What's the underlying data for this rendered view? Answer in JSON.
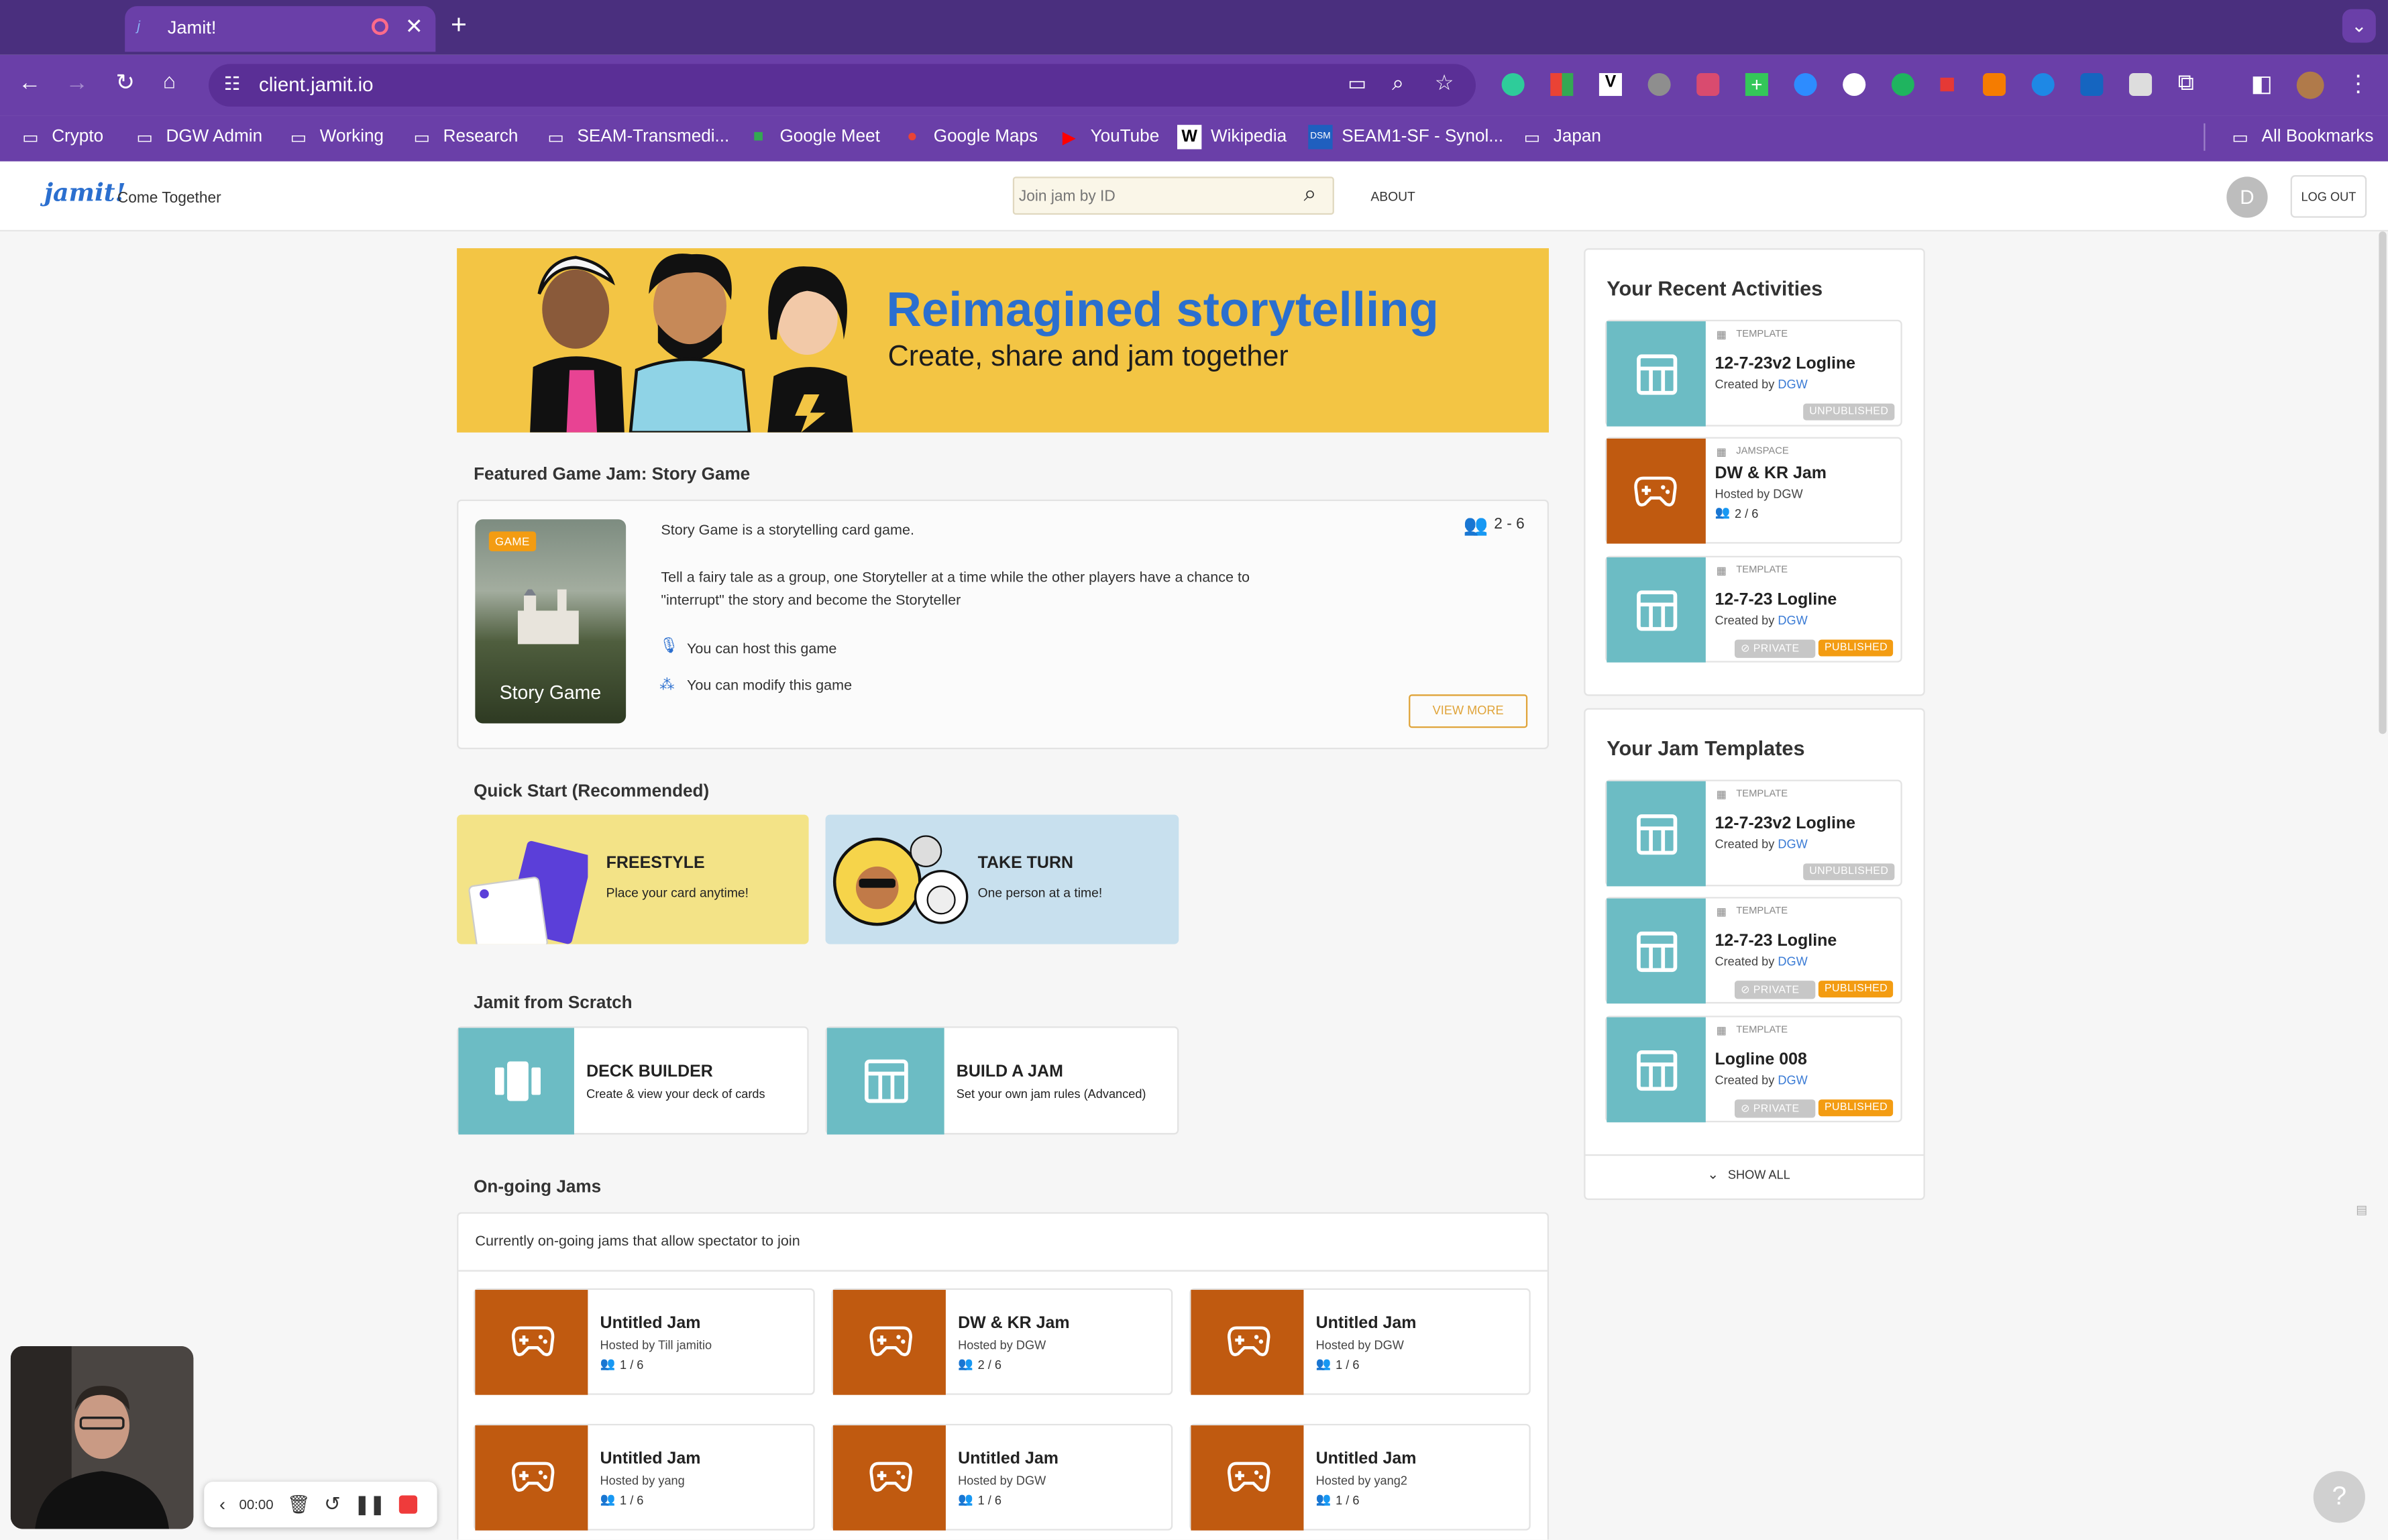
{
  "browser": {
    "tab_title": "Jamit!",
    "new_tab": "+",
    "url": "client.jamit.io",
    "bookmarks": [
      "Crypto",
      "DGW Admin",
      "Working",
      "Research",
      "SEAM-Transmedi...",
      "Google Meet",
      "Google Maps",
      "YouTube",
      "Wikipedia",
      "SEAM1-SF - Synol...",
      "Japan"
    ],
    "all_bookmarks": "All Bookmarks"
  },
  "header": {
    "logo": "jamit!",
    "tagline": "Come Together",
    "search_placeholder": "Join jam by ID",
    "about": "ABOUT",
    "avatar_letter": "D",
    "logout": "LOG OUT"
  },
  "hero": {
    "title": "Reimagined storytelling",
    "subtitle": "Create, share and jam together"
  },
  "featured": {
    "section": "Featured Game Jam: Story Game",
    "badge": "GAME",
    "card_title": "Story Game",
    "players": "2 - 6",
    "desc1": "Story Game is a storytelling card game.",
    "desc2": "Tell a fairy tale as a group, one Storyteller at a time while the other players have a chance to \"interrupt\" the story and become the Storyteller",
    "host": "You can host this game",
    "modify": "You can modify this game",
    "view_more": "VIEW MORE"
  },
  "quick_start": {
    "section": "Quick Start (Recommended)",
    "freestyle_title": "FREESTYLE",
    "freestyle_sub": "Place your card anytime!",
    "take_turn_title": "TAKE TURN",
    "take_turn_sub": "One person at a time!"
  },
  "scratch": {
    "section": "Jamit from Scratch",
    "deck_title": "DECK BUILDER",
    "deck_sub": "Create & view your deck of cards",
    "build_title": "BUILD A JAM",
    "build_sub": "Set your own jam rules (Advanced)"
  },
  "ongoing": {
    "section": "On-going Jams",
    "note": "Currently on-going jams that allow spectator to join",
    "jams": [
      {
        "title": "Untitled Jam",
        "host": "Hosted by Till jamitio",
        "count": "1 / 6"
      },
      {
        "title": "DW & KR Jam",
        "host": "Hosted by DGW",
        "count": "2 / 6"
      },
      {
        "title": "Untitled Jam",
        "host": "Hosted by DGW",
        "count": "1 / 6"
      },
      {
        "title": "Untitled Jam",
        "host": "Hosted by yang",
        "count": "1 / 6"
      },
      {
        "title": "Untitled Jam",
        "host": "Hosted by DGW",
        "count": "1 / 6"
      },
      {
        "title": "Untitled Jam",
        "host": "Hosted by yang2",
        "count": "1 / 6"
      }
    ]
  },
  "recent": {
    "title": "Your Recent Activities",
    "items": [
      {
        "kind": "TEMPLATE",
        "title": "12-7-23v2 Logline",
        "by": "Created by ",
        "who": "DGW",
        "status": "UNPUBLISHED"
      },
      {
        "kind": "JAMSPACE",
        "title": "DW & KR Jam",
        "by": "Hosted by DGW",
        "count": "2 / 6"
      },
      {
        "kind": "TEMPLATE",
        "title": "12-7-23 Logline",
        "by": "Created by ",
        "who": "DGW",
        "private": "PRIVATE",
        "status": "PUBLISHED"
      }
    ]
  },
  "templates": {
    "title": "Your Jam Templates",
    "items": [
      {
        "kind": "TEMPLATE",
        "title": "12-7-23v2 Logline",
        "by": "Created by ",
        "who": "DGW",
        "status": "UNPUBLISHED"
      },
      {
        "kind": "TEMPLATE",
        "title": "12-7-23 Logline",
        "by": "Created by ",
        "who": "DGW",
        "private": "PRIVATE",
        "status": "PUBLISHED"
      },
      {
        "kind": "TEMPLATE",
        "title": "Logline 008",
        "by": "Created by ",
        "who": "DGW",
        "private": "PRIVATE",
        "status": "PUBLISHED"
      }
    ],
    "show_all": "SHOW ALL"
  },
  "recorder": {
    "time": "00:00"
  },
  "help": "?",
  "colors": {
    "brand_purple": "#6a3fa8",
    "teal": "#6cbcc4",
    "rust": "#c05a10",
    "banner_yellow": "#f3c544",
    "hero_blue": "#2b6fcf",
    "published": "#f39c12"
  }
}
